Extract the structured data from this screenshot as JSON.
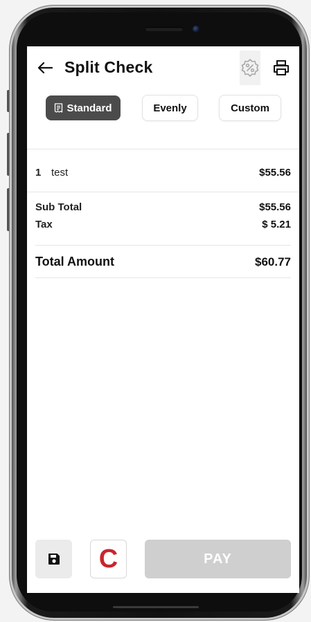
{
  "header": {
    "back_icon": "arrow-left-icon",
    "title": "Split Check",
    "discount_icon": "percent-badge-icon",
    "print_icon": "printer-icon"
  },
  "tabs": [
    {
      "label": "Standard",
      "icon": "receipt-icon",
      "active": true
    },
    {
      "label": "Evenly",
      "active": false
    },
    {
      "label": "Custom",
      "active": false
    }
  ],
  "items": [
    {
      "qty": "1",
      "name": "test",
      "price": "$55.56"
    }
  ],
  "summary": {
    "subtotal_label": "Sub Total",
    "subtotal_value": "$55.56",
    "tax_label": "Tax",
    "tax_value": "$ 5.21",
    "total_label": "Total Amount",
    "total_value": "$60.77"
  },
  "footer": {
    "save_icon": "floppy-disk-icon",
    "logo_letter": "C",
    "pay_label": "PAY"
  },
  "colors": {
    "active_tab": "#4b4b4b",
    "logo_red": "#c8262c",
    "pay_disabled_bg": "#cfcfcf"
  }
}
